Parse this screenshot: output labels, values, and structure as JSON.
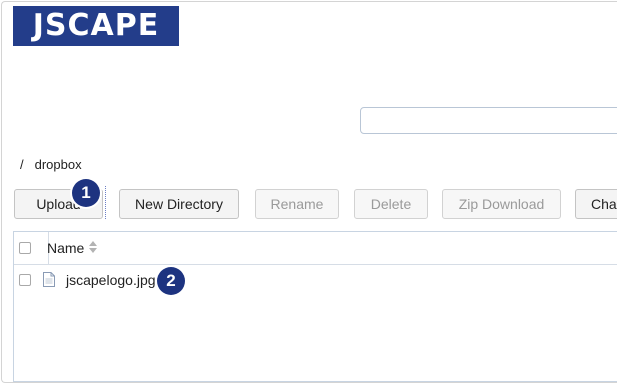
{
  "logo": {
    "text": "JSCAPE"
  },
  "search": {
    "value": "",
    "placeholder": ""
  },
  "breadcrumb": {
    "separator": "/",
    "current": "dropbox"
  },
  "toolbar": {
    "upload_label": "Upload",
    "new_directory_label": "New Directory",
    "rename_label": "Rename",
    "delete_label": "Delete",
    "zip_download_label": "Zip Download",
    "change_label": "Cha"
  },
  "table": {
    "columns": {
      "name": "Name"
    },
    "rows": [
      {
        "name": "jscapelogo.jpg"
      }
    ]
  },
  "callouts": {
    "one": "1",
    "two": "2"
  },
  "colors": {
    "brand": "#233d8a",
    "callout": "#1d3380",
    "disabled_text": "#9a9a9a"
  },
  "icons": {
    "sort": "sort-arrows-icon",
    "file": "file-icon"
  }
}
